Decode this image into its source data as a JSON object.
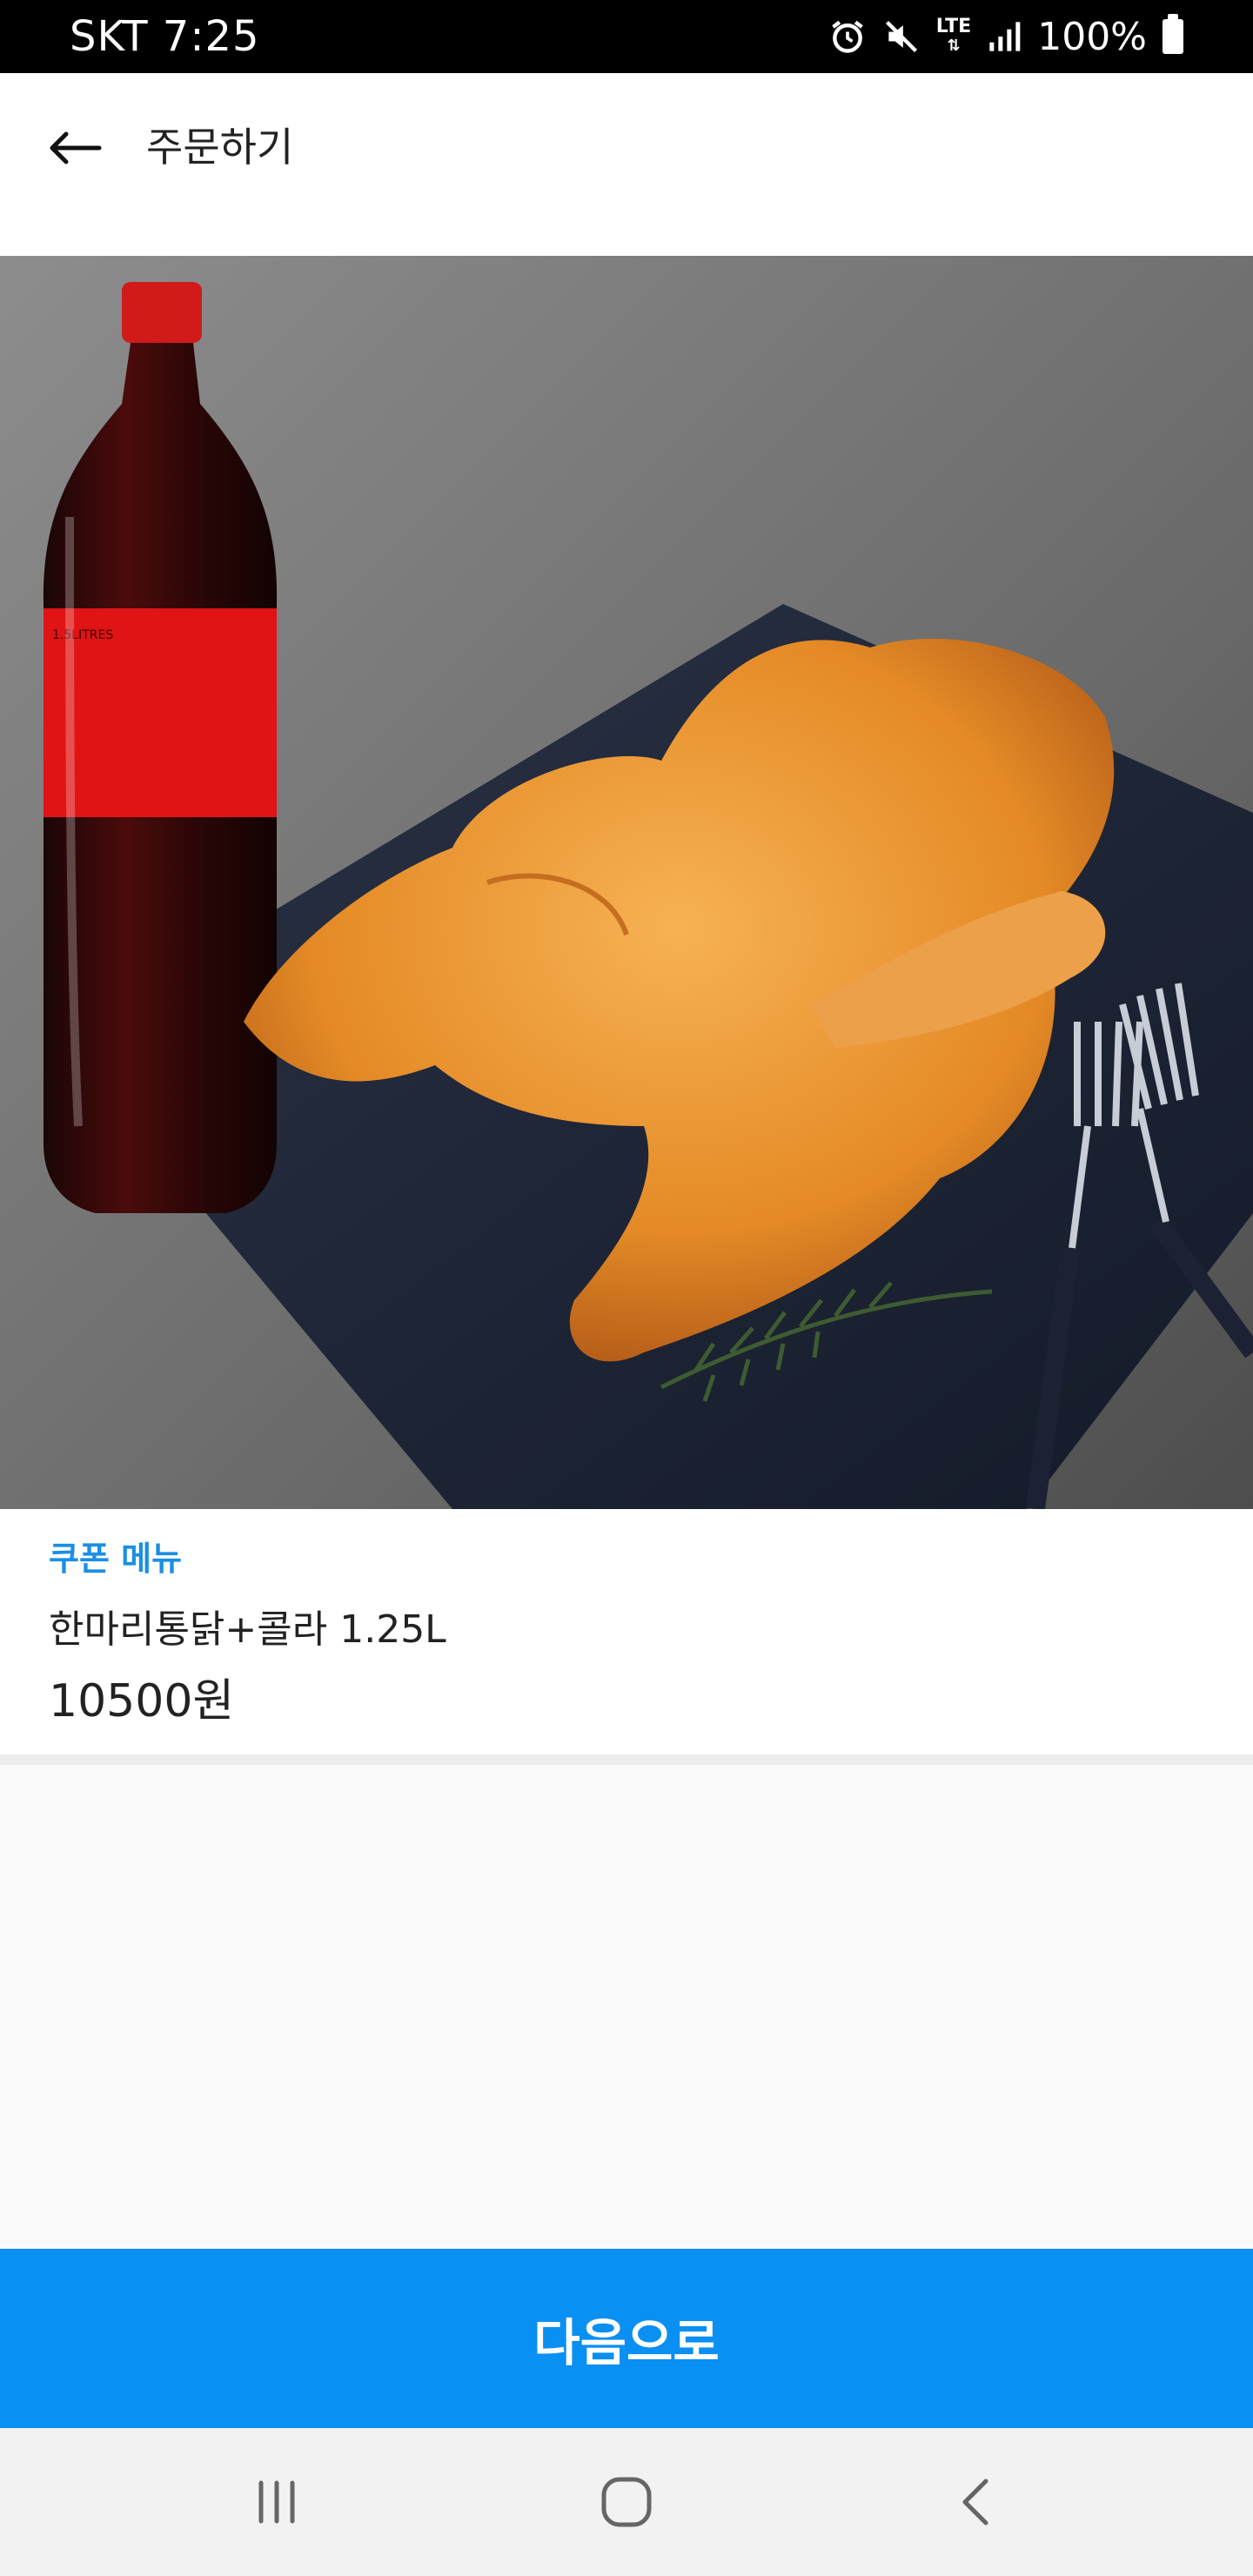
{
  "status_bar": {
    "carrier_time": "SKT 7:25",
    "network": "LTE",
    "battery": "100%",
    "icons": [
      "alarm-icon",
      "mute-icon",
      "lte-icon",
      "signal-icon",
      "battery-icon"
    ]
  },
  "header": {
    "title": "주문하기",
    "back_icon": "arrow-left-icon"
  },
  "hero_image": {
    "bottle_label_text": "1.5LITRES"
  },
  "product": {
    "badge": "쿠폰 메뉴",
    "name": "한마리통닭+콜라 1.25L",
    "price": "10500원"
  },
  "actions": {
    "next_label": "다음으로"
  },
  "nav_bar": {
    "items": [
      "recent-apps-icon",
      "home-icon",
      "back-icon"
    ]
  },
  "colors": {
    "accent": "#0a8ff2",
    "badge": "#1a8fe3",
    "status_bar_bg": "#000000",
    "nav_bg": "#f2f2f2"
  }
}
